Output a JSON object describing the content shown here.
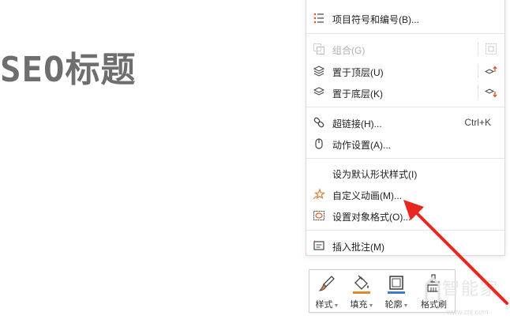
{
  "slide": {
    "title": "SEO标题"
  },
  "menu": {
    "items": [
      {
        "label": "项目符号和编号(B)...",
        "icon": "bullet-list-icon"
      },
      {
        "label": "组合(G)",
        "icon": "group-icon",
        "disabled": true
      },
      {
        "label": "置于顶层(U)",
        "icon": "bring-to-front-icon"
      },
      {
        "label": "置于底层(K)",
        "icon": "send-to-back-icon"
      },
      {
        "label": "超链接(H)...",
        "shortcut": "Ctrl+K",
        "icon": "link-icon"
      },
      {
        "label": "动作设置(A)...",
        "icon": "mouse-icon"
      },
      {
        "label": "设为默认形状样式(I)"
      },
      {
        "label": "自定义动画(M)...",
        "icon": "star-animation-icon"
      },
      {
        "label": "设置对象格式(O)...",
        "icon": "format-object-icon"
      },
      {
        "label": "插入批注(M)",
        "icon": "comment-icon"
      }
    ]
  },
  "toolbar": {
    "buttons": [
      {
        "label": "样式",
        "icon": "brush-style-icon"
      },
      {
        "label": "填充",
        "icon": "fill-bucket-icon",
        "color": "#e6862c"
      },
      {
        "label": "轮廓",
        "icon": "outline-icon",
        "color": "#3a7bd5"
      },
      {
        "label": "格式刷",
        "icon": "format-painter-icon"
      }
    ]
  },
  "watermark": {
    "text": "智能家",
    "url": "www.znj.com"
  },
  "colors": {
    "arrow": "#e8281e",
    "title": "#6e6e6e"
  }
}
